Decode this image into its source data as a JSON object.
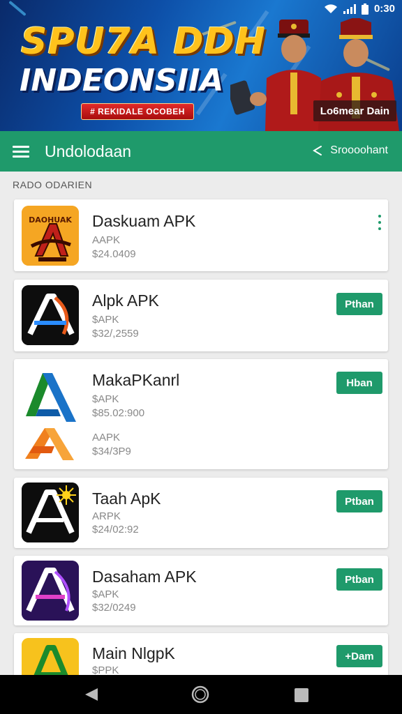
{
  "status_bar": {
    "time": "0:30"
  },
  "banner": {
    "title_line1": "SPU7A DDH",
    "title_line2": "INDEONSIIA",
    "ribbon_text": "# REKIDALE OCOBEH",
    "cta_label": "Lo6mear Dain"
  },
  "app_bar": {
    "title": "Undolodaan",
    "share_label": "Sroooohant",
    "color": "#1f9a6b"
  },
  "section": {
    "label": "RADO ODARIEN"
  },
  "apps": [
    {
      "name": "Daskuam APK",
      "type": "AAPK",
      "price": "$24.0409",
      "icon_text": "DAOHUAK",
      "icon_bg": "#f5a623",
      "action": "more"
    },
    {
      "name": "Alpk APK",
      "type": "$APK",
      "price": "$32/,2559",
      "button": "Pthan",
      "icon_bg": "#0d0d0d"
    },
    {
      "name": "MakaPKanrl",
      "type": "$APK",
      "price": "$85.02:900",
      "type2": "AAPK",
      "price2": "$34/3P9",
      "button": "Hban",
      "icon_bg": "#ffffff"
    },
    {
      "name": "Taah ApK",
      "type": "ARPK",
      "price": "$24/02:92",
      "button": "Ptban",
      "icon_bg": "#0d0d0d"
    },
    {
      "name": "Dasaham APK",
      "type": "$APK",
      "price": "$32/0249",
      "button": "Ptban",
      "icon_bg": "#2a1258"
    },
    {
      "name": "Main NlgpK",
      "type": "$PPK",
      "price": "",
      "button": "+Dam",
      "icon_bg": "#f7c21d"
    }
  ],
  "icons": [
    "wifi-icon",
    "signal-icon",
    "battery-icon",
    "menu-icon",
    "share-icon",
    "more-vert-icon",
    "back-icon",
    "home-icon",
    "recents-icon"
  ]
}
